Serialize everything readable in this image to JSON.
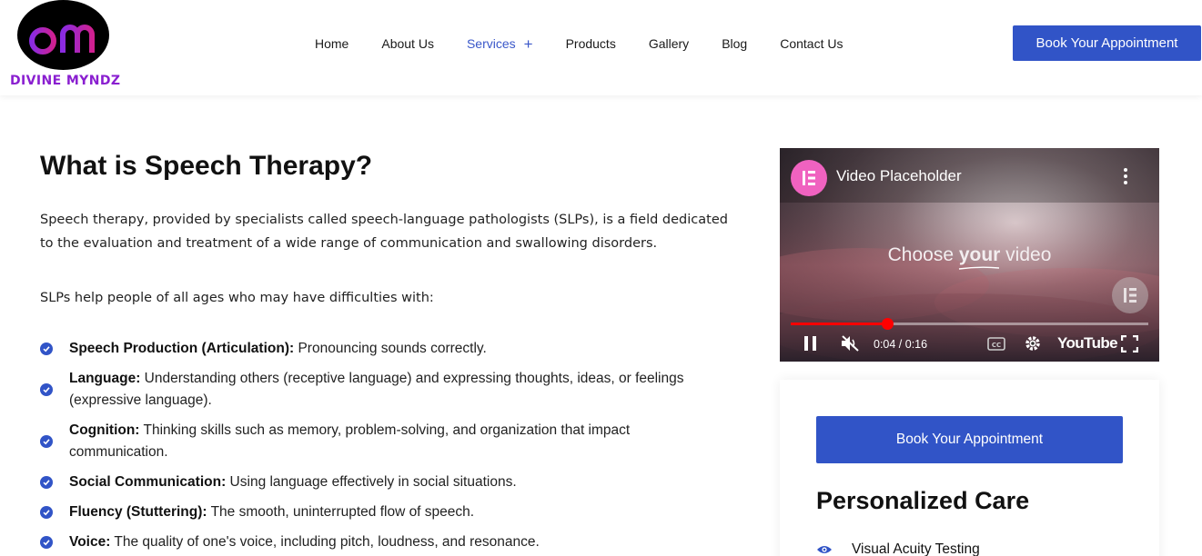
{
  "colors": {
    "accent": "#3154c7",
    "nav_active": "#3a57c9",
    "logo_purple": "#8a1fd0",
    "youtube_red": "#ff0000",
    "elementor_pink": "#f062c0"
  },
  "brand": {
    "logo_text": "DIVINE MYNDZ",
    "logo_mark": "dm"
  },
  "nav": {
    "items": [
      {
        "label": "Home"
      },
      {
        "label": "About Us"
      },
      {
        "label": "Services",
        "active": true,
        "submenu_icon": "plus-icon"
      },
      {
        "label": "Products"
      },
      {
        "label": "Gallery"
      },
      {
        "label": "Blog"
      },
      {
        "label": "Contact Us"
      }
    ],
    "cta_label": "Book Your Appointment"
  },
  "main": {
    "title": "What is Speech Therapy?",
    "intro": "Speech therapy, provided by specialists called speech-language pathologists (SLPs), is a field dedicated to the evaluation and treatment of a wide range of communication and swallowing disorders.",
    "lead": "SLPs help people of all ages who may have difficulties with:",
    "features": [
      {
        "term": "Speech Production (Articulation):",
        "text": " Pronouncing sounds correctly."
      },
      {
        "term": "Language:",
        "text": " Understanding others (receptive language) and expressing thoughts, ideas, or feelings (expressive language)."
      },
      {
        "term": "Cognition:",
        "text": " Thinking skills such as memory, problem-solving, and organization that impact communication."
      },
      {
        "term": "Social Communication:",
        "text": " Using language effectively in social situations."
      },
      {
        "term": "Fluency (Stuttering):",
        "text": " The smooth, uninterrupted flow of speech."
      },
      {
        "term": "Voice:",
        "text": " The quality of one's voice, including pitch, loudness, and resonance."
      }
    ]
  },
  "video": {
    "title": "Video Placeholder",
    "center_prefix": "Choose ",
    "center_bold": "your",
    "center_suffix": " video",
    "time": "0:04 / 0:16",
    "progress": 0.27,
    "platform": "YouTube",
    "icons": [
      "elementor-icon",
      "more-vert-icon",
      "pause-icon",
      "mute-icon",
      "captions-icon",
      "settings-icon",
      "fullscreen-icon"
    ]
  },
  "sidebar": {
    "cta_label": "Book Your Appointment",
    "heading": "Personalized Care",
    "items": [
      {
        "label": "Visual Acuity Testing",
        "icon": "eye-icon"
      }
    ]
  }
}
